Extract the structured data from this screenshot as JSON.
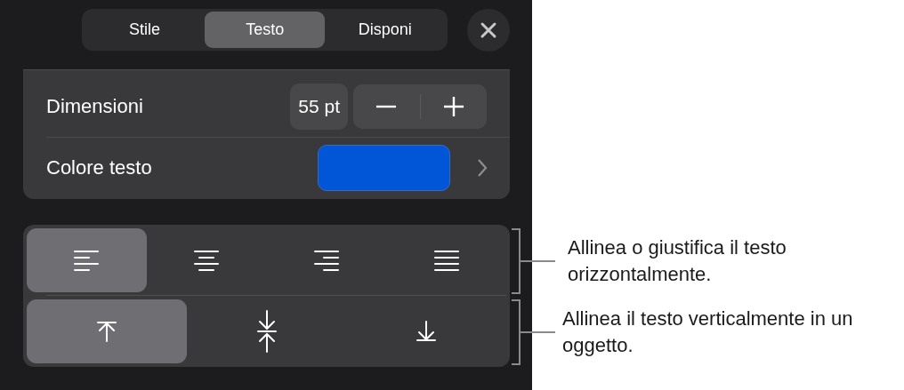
{
  "tabs": [
    {
      "label": "Stile",
      "selected": false
    },
    {
      "label": "Testo",
      "selected": true
    },
    {
      "label": "Disponi",
      "selected": false
    }
  ],
  "text_settings": [
    {
      "kind": "stepper",
      "label": "Dimensioni",
      "value": "55 pt"
    },
    {
      "kind": "color",
      "label": "Colore testo",
      "color": "#0056d6"
    }
  ],
  "horizontal_alignment": [
    {
      "kind": "left",
      "selected": true
    },
    {
      "kind": "center",
      "selected": false
    },
    {
      "kind": "right",
      "selected": false
    },
    {
      "kind": "justify",
      "selected": false
    }
  ],
  "vertical_alignment": [
    {
      "kind": "top",
      "selected": true
    },
    {
      "kind": "middle",
      "selected": false
    },
    {
      "kind": "bottom",
      "selected": false
    }
  ],
  "callouts": [
    "Allinea o giustifica il testo orizzontalmente.",
    "Allinea il testo verticalmente in un oggetto."
  ]
}
